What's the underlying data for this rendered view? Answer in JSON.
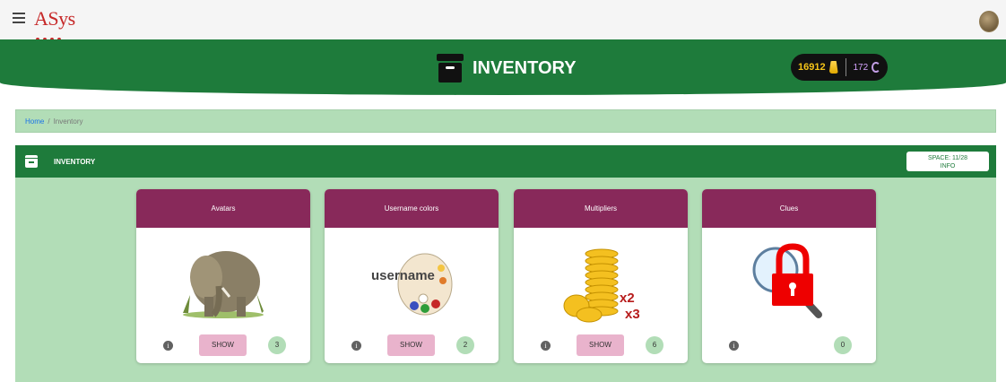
{
  "topbar": {
    "logo": "ASys",
    "icons": {
      "menu": "hamburger-menu-icon",
      "avatar": "user-avatar"
    }
  },
  "banner": {
    "title": "INVENTORY",
    "icon": "archive-box-icon",
    "currency_gold": "16912",
    "currency_gold_icon": "coin-bag-icon",
    "currency_purple": "172",
    "currency_purple_icon": "moon-icon"
  },
  "breadcrumb": {
    "home": "Home",
    "separator": "/",
    "current": "Inventory"
  },
  "panel": {
    "title": "INVENTORY",
    "space_line1": "SPACE: 11/28",
    "space_line2": "INFO"
  },
  "cards": [
    {
      "title": "Avatars",
      "show_label": "SHOW",
      "count": "3",
      "image": "elephant-image"
    },
    {
      "title": "Username colors",
      "show_label": "SHOW",
      "count": "2",
      "image_text": "username",
      "image": "palette-image"
    },
    {
      "title": "Multipliers",
      "show_label": "SHOW",
      "count": "6",
      "image_text1": "x2",
      "image_text2": "x3",
      "image": "coins-image"
    },
    {
      "title": "Clues",
      "count": "0",
      "image": "locked-magnifier-image"
    }
  ],
  "colors": {
    "brand_green": "#1e7b3b",
    "light_green": "#b2ddb7",
    "card_header": "#88295a",
    "show_button": "#e9b3cc"
  }
}
